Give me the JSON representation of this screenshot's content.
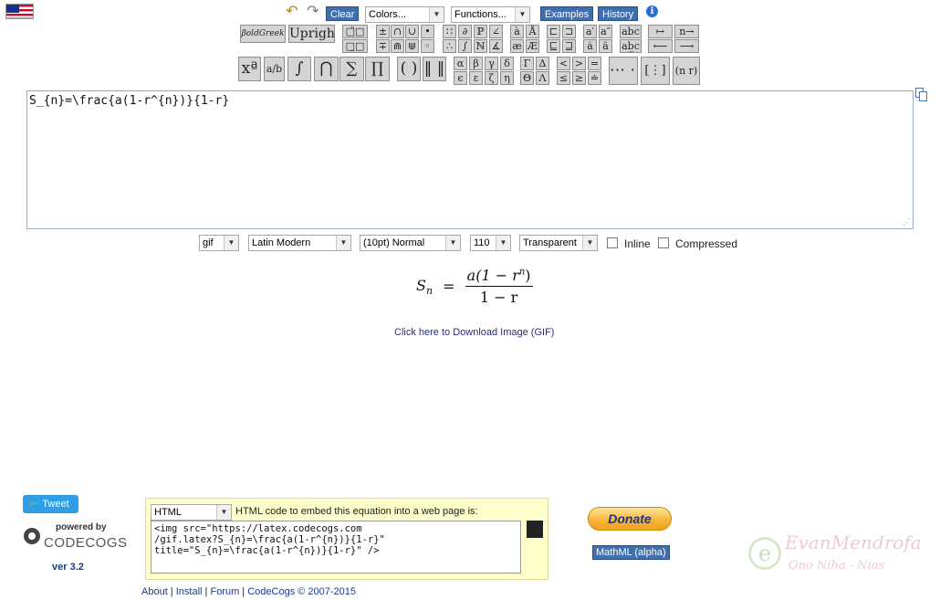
{
  "toolbar": {
    "clear_label": "Clear",
    "colors_select": "Colors...",
    "functions_select": "Functions...",
    "examples_label": "Examples",
    "history_label": "History",
    "info_glyph": "i",
    "undo_glyph": "↶",
    "redo_glyph": "↷"
  },
  "symbols": {
    "row1": [
      "βoldGreek",
      "Upright"
    ],
    "group_a": [
      "□̈□",
      "±",
      "∩",
      "∪",
      "•",
      "∷",
      "∂",
      "ℙ",
      "∠",
      "à",
      "Å",
      "⊏",
      "⊐",
      "a′",
      "a″",
      "abc",
      "↦",
      "n→"
    ],
    "group_b": [
      "□̤□",
      "∓",
      "⋒",
      "⋓",
      "◦",
      "∴",
      "∫",
      "ℕ",
      "∡",
      "æ",
      "Æ",
      "⊑",
      "⊒",
      "ȧ",
      "ä",
      "ab̲c",
      "⟵",
      "⟶"
    ],
    "row3": [
      "xª",
      "a/b",
      "∫",
      "⋂",
      "∑",
      "∏",
      "( )",
      "‖ ‖"
    ],
    "greek_a": [
      "α",
      "β",
      "γ",
      "δ",
      "Γ",
      "Δ",
      "<",
      ">",
      "="
    ],
    "greek_b": [
      "ϵ",
      "ε",
      "ζ",
      "η",
      "Θ",
      "Λ",
      "≤",
      "≥",
      "≐"
    ],
    "matrix": [
      "⋯ ⋯",
      "[⋮]",
      "(n r)"
    ]
  },
  "editor": {
    "content": "S_{n}=\\frac{a(1-r^{n})}{1-r}"
  },
  "options": {
    "format": "gif",
    "font": "Latin Modern",
    "size": "(10pt) Normal",
    "dpi": "110",
    "background": "Transparent",
    "inline_label": "Inline",
    "compressed_label": "Compressed"
  },
  "preview": {
    "lhs": "S",
    "lhs_sub": "n",
    "eq": "=",
    "numerator": "a(1 − r",
    "numerator_sup": "n",
    "numerator_close": ")",
    "denominator": "1 − r"
  },
  "download_link": "Click here to Download Image (GIF)",
  "social": {
    "tweet_label": "Tweet",
    "powered_by": "powered by",
    "brand": "CODECOGS",
    "version": "ver 3.2"
  },
  "embed": {
    "type_select": "HTML",
    "caption": "HTML code to embed this equation into a web page is:",
    "code": "<img src=\"https://latex.codecogs.com\n/gif.latex?S_{n}=\\frac{a(1-r^{n})}{1-r}\"\ntitle=\"S_{n}=\\frac{a(1-r^{n})}{1-r}\" />"
  },
  "donate_label": "Donate",
  "mathml_label": "MathML (alpha)",
  "footer": {
    "about": "About",
    "install": "Install",
    "forum": "Forum",
    "copyright": "CodeCogs © 2007-2015"
  },
  "watermark": {
    "line1": "EvanMendrofa",
    "line2": "Ono Niha - Nias"
  },
  "colors": {
    "accent_button": "#3f6fb0",
    "tweet": "#2e9ee6",
    "donate": "#f5b336"
  }
}
